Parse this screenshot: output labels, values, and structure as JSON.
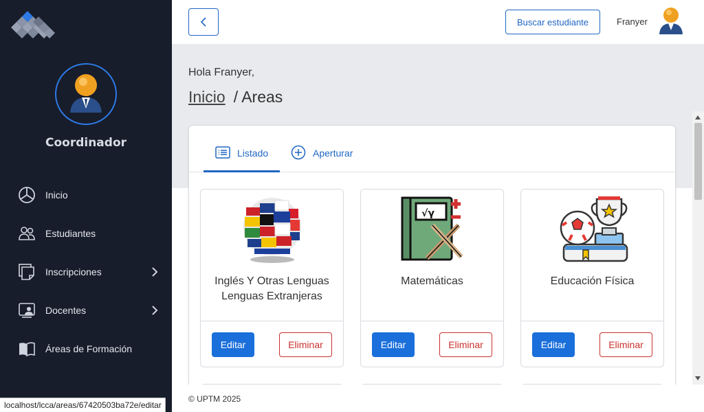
{
  "sidebar": {
    "role": "Coordinador",
    "items": [
      {
        "label": "Inicio",
        "icon": "pie-chart-icon"
      },
      {
        "label": "Estudiantes",
        "icon": "users-icon"
      },
      {
        "label": "Inscripciones",
        "icon": "forms-icon"
      },
      {
        "label": "Docentes",
        "icon": "teacher-icon"
      },
      {
        "label": "Áreas de Formación",
        "icon": "book-icon"
      }
    ]
  },
  "header": {
    "search_button": "Buscar estudiante",
    "username": "Franyer"
  },
  "page": {
    "greeting": "Hola Franyer,",
    "breadcrumb_home": "Inicio",
    "breadcrumb_sep": "/",
    "breadcrumb_current": "Areas"
  },
  "tabs": [
    {
      "label": "Listado",
      "active": true
    },
    {
      "label": "Aperturar",
      "active": false
    }
  ],
  "cards": [
    {
      "title_line1": "Inglés Y Otras Lenguas",
      "title_line2": "Lenguas Extranjeras",
      "image": "globe-flags-icon",
      "edit": "Editar",
      "delete": "Eliminar"
    },
    {
      "title_line1": "Matemáticas",
      "title_line2": "",
      "image": "math-notebook-icon",
      "edit": "Editar",
      "delete": "Eliminar"
    },
    {
      "title_line1": "Educación Física",
      "title_line2": "",
      "image": "sports-trophy-icon",
      "edit": "Editar",
      "delete": "Eliminar"
    }
  ],
  "footer": {
    "copyright": "© UPTM 2025",
    "status_url": "localhost/lcca/areas/67420503ba72e/editar"
  },
  "colors": {
    "sidebar_bg": "#171d2b",
    "primary": "#1a6fdb",
    "danger": "#c9302c",
    "content_bg": "#e9eaed"
  }
}
